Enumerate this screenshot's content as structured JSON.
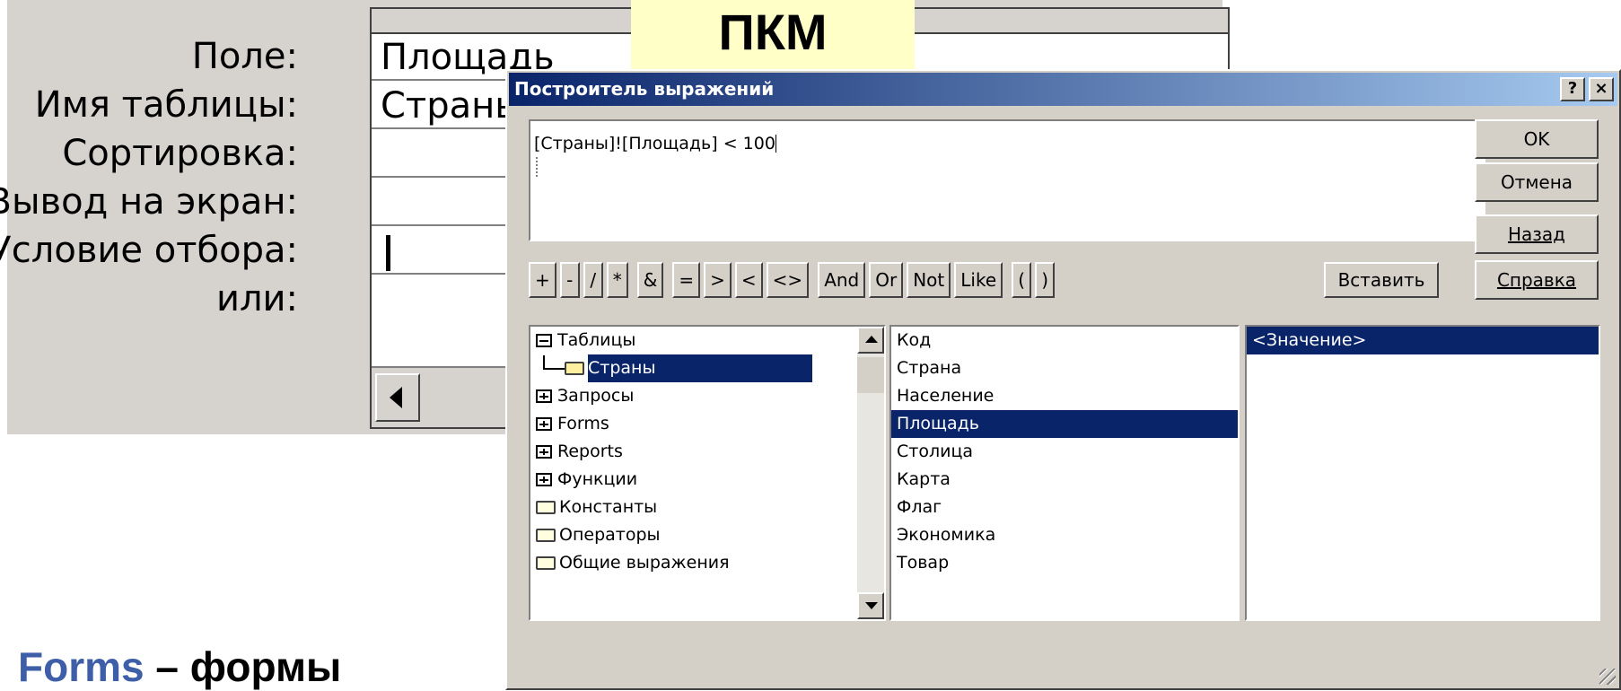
{
  "query_grid": {
    "labels": [
      "Поле:",
      "Имя таблицы:",
      "Сортировка:",
      "Вывод на экран:",
      "Условие отбора:",
      "или:"
    ],
    "field_value": "Площадь",
    "table_value": "Страны"
  },
  "callout": "ПКМ",
  "caption": {
    "keyword": "Forms",
    "rest": " – формы"
  },
  "dialog": {
    "title": "Построитель выражений",
    "help_button": "?",
    "close_button": "×",
    "expression": "[Страны]![Площадь] < 100",
    "buttons": {
      "ok": "OK",
      "cancel": "Отмена",
      "back": "Назад",
      "help": "Справка",
      "paste": "Вставить"
    },
    "operators": [
      "+",
      "-",
      "/",
      "*",
      "&",
      "=",
      ">",
      "<",
      "<>",
      "And",
      "Or",
      "Not",
      "Like",
      "(",
      ")"
    ],
    "tree": [
      {
        "label": "Таблицы",
        "icon": "minus-box-icon"
      },
      {
        "label": "Страны",
        "icon": "open-folder-icon",
        "selected": true
      },
      {
        "label": "Запросы",
        "icon": "plus-box-icon"
      },
      {
        "label": "Forms",
        "icon": "plus-box-icon"
      },
      {
        "label": "Reports",
        "icon": "plus-box-icon"
      },
      {
        "label": "Функции",
        "icon": "plus-box-icon"
      },
      {
        "label": "Константы",
        "icon": "folder-icon"
      },
      {
        "label": "Операторы",
        "icon": "folder-icon"
      },
      {
        "label": "Общие выражения",
        "icon": "folder-icon"
      }
    ],
    "fields": [
      "Код",
      "Страна",
      "Население",
      "Площадь",
      "Столица",
      "Карта",
      "Флаг",
      "Экономика",
      "Товар"
    ],
    "selected_field": "Площадь",
    "values": [
      "<Значение>"
    ]
  },
  "colors": {
    "titlebar": "#0a246a",
    "selection": "#0a246a",
    "caption_keyword": "#3e5fa8",
    "callout": "#ffffc8"
  }
}
